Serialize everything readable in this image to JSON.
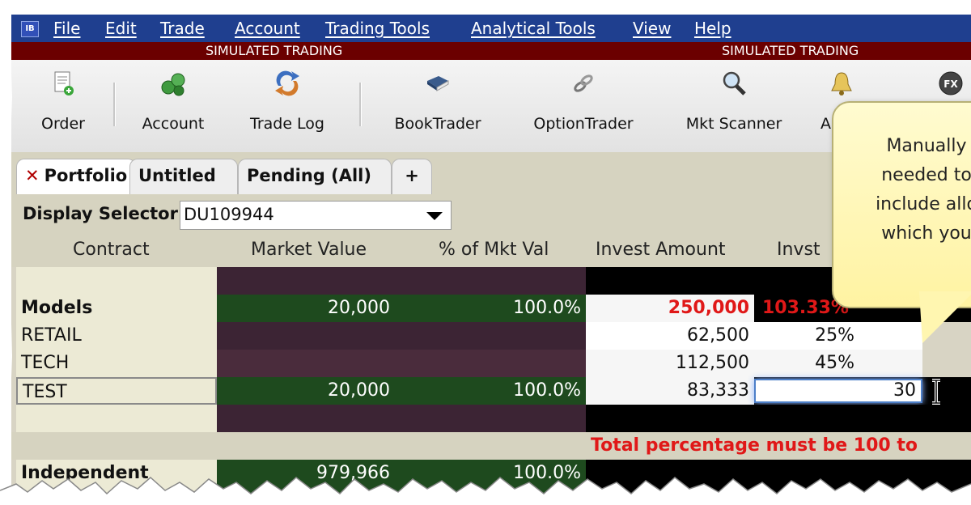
{
  "app": {
    "logo": "IB"
  },
  "menu": [
    "File",
    "Edit",
    "Trade",
    "Account",
    "Trading Tools",
    "Analytical Tools",
    "View",
    "Help"
  ],
  "sim_banner": [
    "SIMULATED TRADING",
    "SIMULATED TRADING"
  ],
  "toolbar": [
    {
      "label": "Order",
      "icon": "order-icon"
    },
    {
      "label": "Account",
      "icon": "account-icon"
    },
    {
      "label": "Trade Log",
      "icon": "trade-log-icon"
    },
    {
      "label": "BookTrader",
      "icon": "book-icon"
    },
    {
      "label": "OptionTrader",
      "icon": "option-trader-icon"
    },
    {
      "label": "Mkt Scanner",
      "icon": "magnifier-icon"
    },
    {
      "label": "A",
      "icon": "bell-icon"
    },
    {
      "label": "",
      "icon": "fx-icon"
    }
  ],
  "tabs": [
    {
      "label": "Portfolio",
      "close": "✕"
    },
    {
      "label": "Untitled"
    },
    {
      "label": "Pending (All)"
    },
    {
      "label": "+"
    }
  ],
  "selector": {
    "label": "Display Selector",
    "value": "DU109944"
  },
  "columns": [
    "Contract",
    "Market Value",
    "% of Mkt Val",
    "Invest Amount",
    "Invst"
  ],
  "rows": [
    {
      "contract": "",
      "mv": "",
      "pct": "",
      "invest": "",
      "invst": ""
    },
    {
      "contract": "Models",
      "mv": "20,000",
      "pct": "100.0%",
      "invest": "250,000",
      "invst": "103.33%"
    },
    {
      "contract": "RETAIL",
      "mv": "",
      "pct": "",
      "invest": "62,500",
      "invst": "25%"
    },
    {
      "contract": "TECH",
      "mv": "",
      "pct": "",
      "invest": "112,500",
      "invst": "45%"
    },
    {
      "contract": "TEST",
      "mv": "20,000",
      "pct": "100.0%",
      "invest": "83,333",
      "invst": "30"
    },
    {
      "contract": "",
      "mv": "",
      "pct": "",
      "invest": "",
      "invst": ""
    },
    {
      "contract": "",
      "mv": "",
      "pct": "",
      "invest": "",
      "invst": "Total percentage must be 100 to"
    },
    {
      "contract": "Independent",
      "mv": "979,966",
      "pct": "100.0%",
      "invest": "",
      "invst": ""
    }
  ],
  "tooltip": {
    "lines": [
      "Manually",
      "needed to",
      "include allo",
      "which you"
    ]
  },
  "colors": {
    "menu_bg": "#1f3f8f",
    "sim_bg": "#6b0000",
    "error": "#e01818",
    "green_cell": "#1e4a1e",
    "maroon_cell": "#3c2434"
  }
}
